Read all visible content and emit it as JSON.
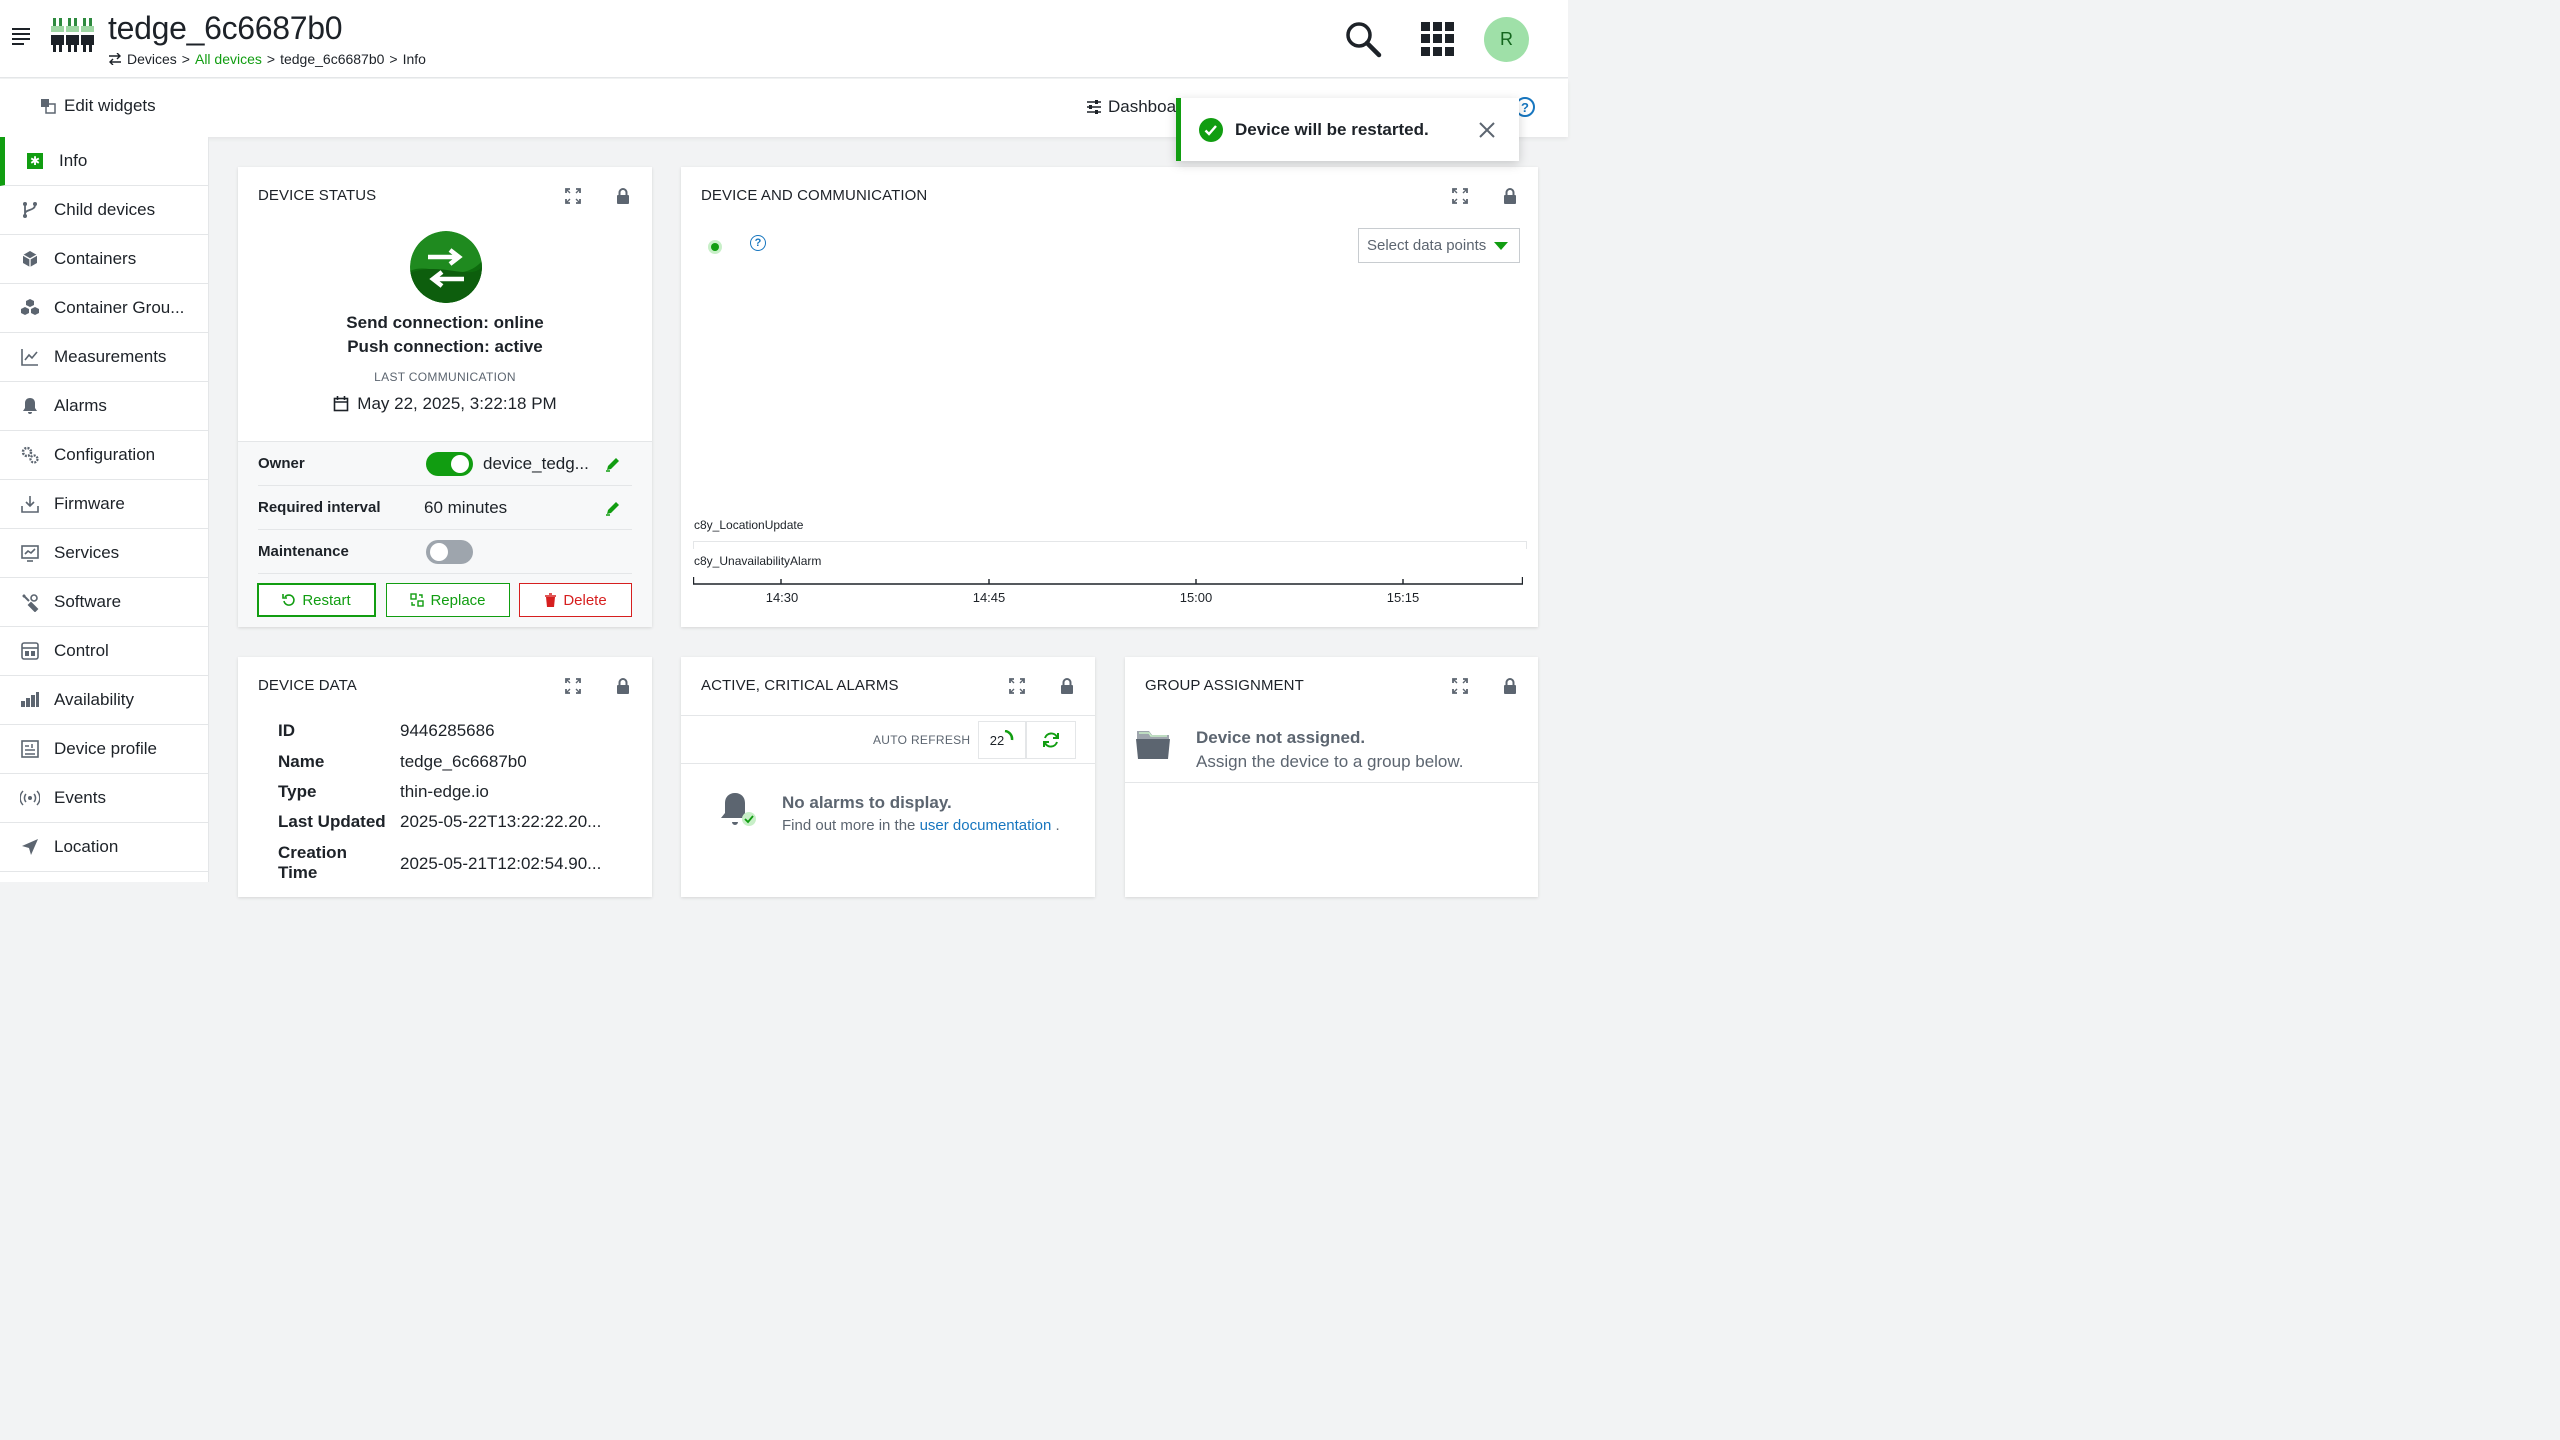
{
  "header": {
    "title": "tedge_6c6687b0",
    "breadcrumb": [
      "Devices",
      "All devices",
      "tedge_6c6687b0",
      "Info"
    ],
    "breadcrumb_sep": ">",
    "avatar_initial": "R"
  },
  "actionbar": {
    "edit_widgets": "Edit widgets",
    "dashboard": "Dashboa"
  },
  "toast": {
    "message": "Device will be restarted.",
    "color": "#119d11"
  },
  "sidebar": {
    "items": [
      {
        "label": "Info",
        "icon": "info-icon",
        "active": true
      },
      {
        "label": "Child devices",
        "icon": "fork-icon"
      },
      {
        "label": "Containers",
        "icon": "cube-icon"
      },
      {
        "label": "Container Grou...",
        "icon": "cubes-icon"
      },
      {
        "label": "Measurements",
        "icon": "line-chart-icon"
      },
      {
        "label": "Alarms",
        "icon": "bell-icon"
      },
      {
        "label": "Configuration",
        "icon": "gears-icon"
      },
      {
        "label": "Firmware",
        "icon": "firmware-icon"
      },
      {
        "label": "Services",
        "icon": "services-icon"
      },
      {
        "label": "Software",
        "icon": "software-icon"
      },
      {
        "label": "Control",
        "icon": "control-icon"
      },
      {
        "label": "Availability",
        "icon": "bar-chart-icon"
      },
      {
        "label": "Device profile",
        "icon": "profile-icon"
      },
      {
        "label": "Events",
        "icon": "broadcast-icon"
      },
      {
        "label": "Location",
        "icon": "location-arrow-icon"
      }
    ]
  },
  "device_status": {
    "title": "DEVICE STATUS",
    "send_connection": "Send connection: online",
    "push_connection": "Push connection: active",
    "last_comm_label": "LAST COMMUNICATION",
    "last_comm_value": "May 22, 2025, 3:22:18 PM",
    "owner_label": "Owner",
    "owner_value": "device_tedg...",
    "owner_toggle_on": true,
    "interval_label": "Required interval",
    "interval_value": "60 minutes",
    "maintenance_label": "Maintenance",
    "maintenance_on": false,
    "restart": "Restart",
    "replace": "Replace",
    "delete": "Delete"
  },
  "device_comm": {
    "title": "DEVICE AND COMMUNICATION",
    "select_label": "Select data points",
    "lanes": [
      "c8y_LocationUpdate",
      "c8y_UnavailabilityAlarm"
    ],
    "ticks": [
      "14:30",
      "14:45",
      "15:00",
      "15:15"
    ]
  },
  "device_data": {
    "title": "DEVICE DATA",
    "rows": [
      {
        "key": "ID",
        "value": "9446285686"
      },
      {
        "key": "Name",
        "value": "tedge_6c6687b0"
      },
      {
        "key": "Type",
        "value": "thin-edge.io"
      },
      {
        "key": "Last Updated",
        "value": "2025-05-22T13:22:22.20..."
      },
      {
        "key": "Creation",
        "key2": "Time",
        "value": "2025-05-21T12:02:54.90..."
      }
    ]
  },
  "alarms": {
    "title": "ACTIVE, CRITICAL ALARMS",
    "auto_refresh": "AUTO REFRESH",
    "countdown": "22",
    "empty_title": "No alarms to display.",
    "empty_sub_prefix": "Find out more in the",
    "empty_link": "user documentation",
    "empty_suffix": "."
  },
  "group": {
    "title": "GROUP ASSIGNMENT",
    "empty_title": "Device not assigned.",
    "empty_sub": "Assign the device to a group below."
  }
}
